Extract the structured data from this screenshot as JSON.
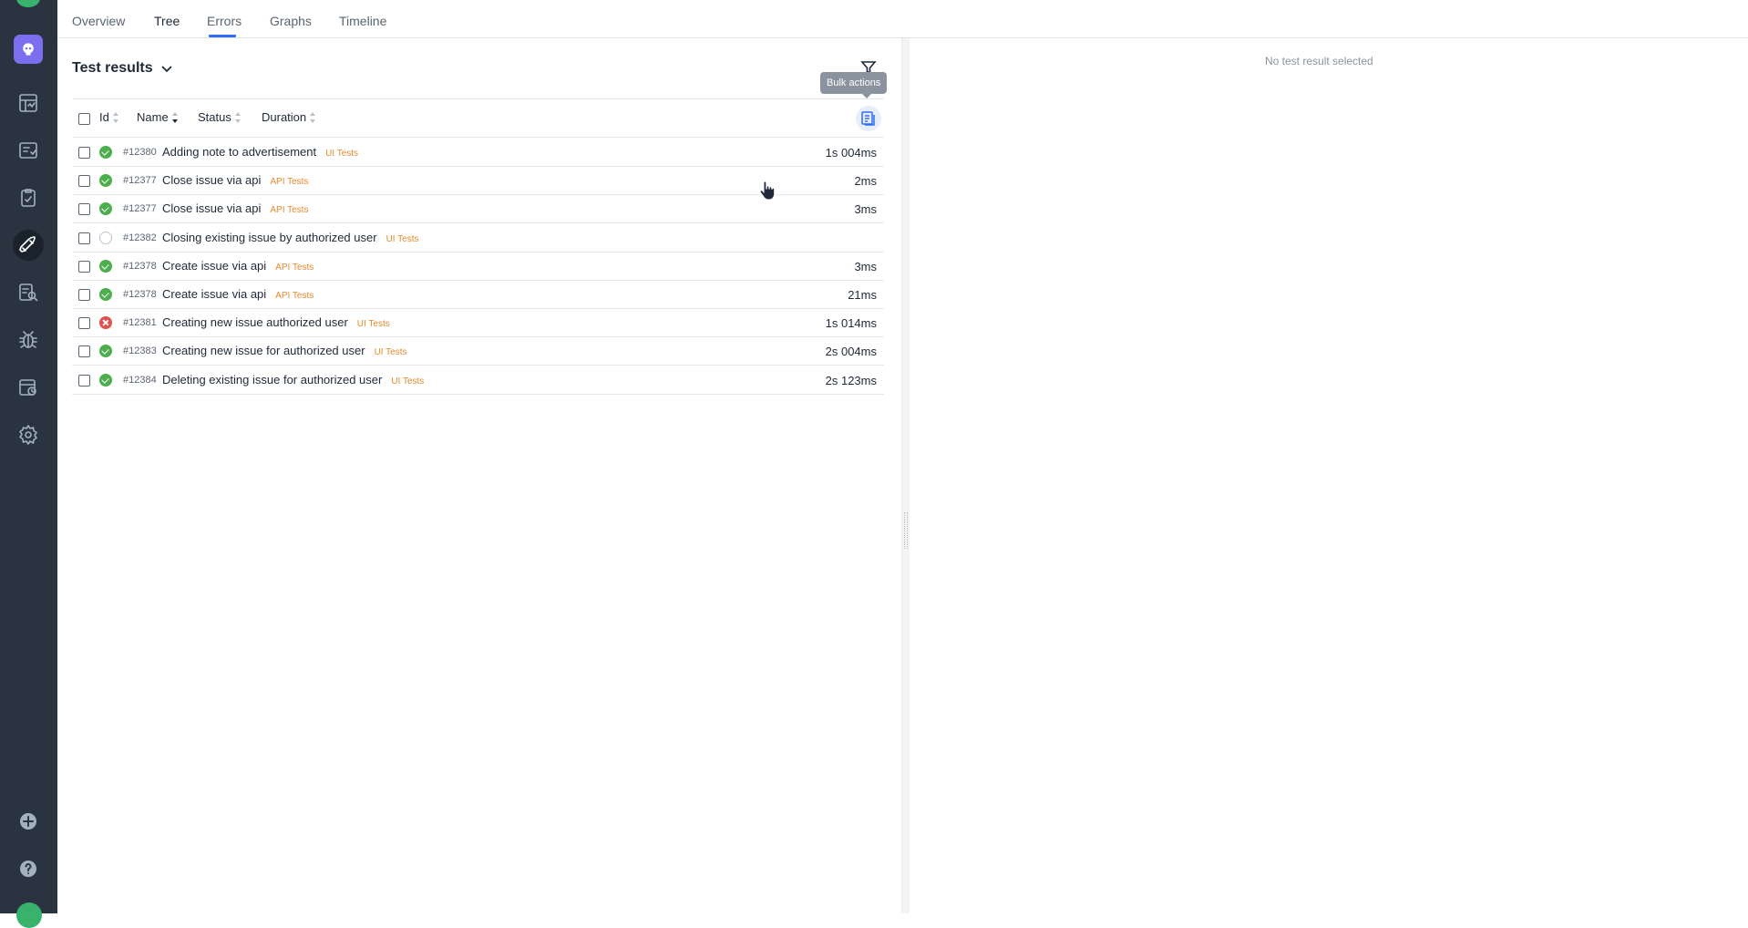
{
  "sidebar": {
    "items": [
      {
        "name": "brand-icon"
      },
      {
        "name": "dashboard-icon"
      },
      {
        "name": "test-cases-icon"
      },
      {
        "name": "test-plans-icon"
      },
      {
        "name": "launches-icon",
        "active": true
      },
      {
        "name": "analytics-icon"
      },
      {
        "name": "defects-icon"
      },
      {
        "name": "jobs-icon"
      },
      {
        "name": "settings-icon"
      },
      {
        "name": "add-icon"
      },
      {
        "name": "help-icon"
      }
    ]
  },
  "tabs": [
    {
      "label": "Overview"
    },
    {
      "label": "Tree",
      "active": true
    },
    {
      "label": "Errors"
    },
    {
      "label": "Graphs"
    },
    {
      "label": "Timeline"
    }
  ],
  "results": {
    "title": "Test results",
    "tooltip": "Bulk actions",
    "columns": {
      "id": "Id",
      "name": "Name",
      "status": "Status",
      "duration": "Duration"
    },
    "rows": [
      {
        "id": "#12380",
        "name": "Adding note to advertisement",
        "tag": "UI Tests",
        "duration": "1s 004ms",
        "status": "passed"
      },
      {
        "id": "#12377",
        "name": "Close issue via api",
        "tag": "API Tests",
        "duration": "2ms",
        "status": "passed"
      },
      {
        "id": "#12377",
        "name": "Close issue via api",
        "tag": "API Tests",
        "duration": "3ms",
        "status": "passed"
      },
      {
        "id": "#12382",
        "name": "Closing existing issue by authorized user",
        "tag": "UI Tests",
        "duration": "",
        "status": "unknown"
      },
      {
        "id": "#12378",
        "name": "Create issue via api",
        "tag": "API Tests",
        "duration": "3ms",
        "status": "passed"
      },
      {
        "id": "#12378",
        "name": "Create issue via api",
        "tag": "API Tests",
        "duration": "21ms",
        "status": "passed"
      },
      {
        "id": "#12381",
        "name": "Creating new issue authorized user",
        "tag": "UI Tests",
        "duration": "1s 014ms",
        "status": "failed"
      },
      {
        "id": "#12383",
        "name": "Creating new issue for authorized user",
        "tag": "UI Tests",
        "duration": "2s 004ms",
        "status": "passed"
      },
      {
        "id": "#12384",
        "name": "Deleting existing issue for authorized user",
        "tag": "UI Tests",
        "duration": "2s 123ms",
        "status": "passed"
      }
    ]
  },
  "detail": {
    "empty_text": "No test result selected"
  },
  "colors": {
    "rail": "#2a3441",
    "accent": "#2f6df6",
    "passed": "#4cae4c",
    "failed": "#e34f4f",
    "tag": "#e68a2e"
  }
}
